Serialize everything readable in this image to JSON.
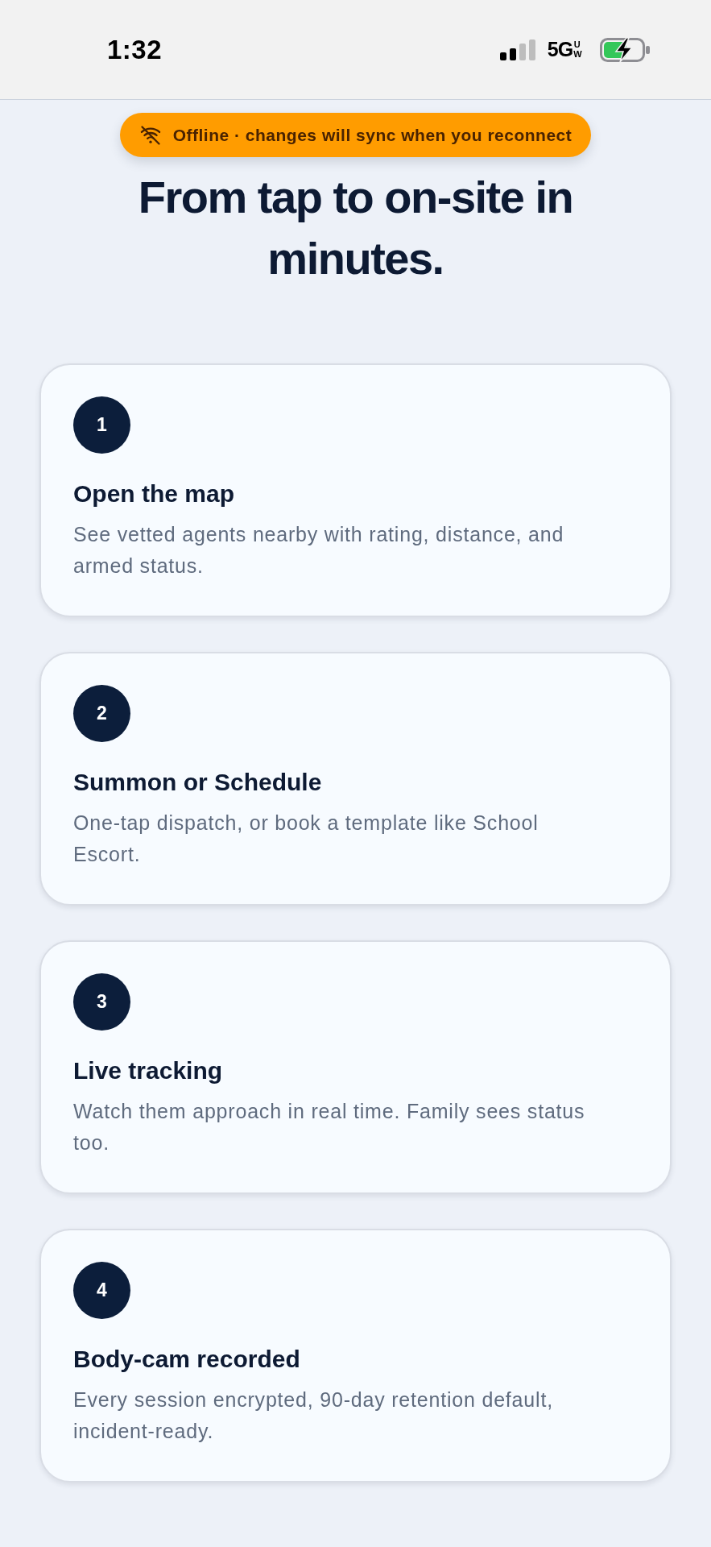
{
  "status_bar": {
    "time": "1:32",
    "network": "5G",
    "network_band": "UW",
    "battery_charging": true
  },
  "offline_banner": {
    "text": "Offline · changes will sync when you reconnect"
  },
  "heading": "From tap to on-site in minutes.",
  "steps": [
    {
      "number": "1",
      "title": "Open the map",
      "description": "See vetted agents nearby with rating, distance, and armed status."
    },
    {
      "number": "2",
      "title": "Summon or Schedule",
      "description": "One-tap dispatch, or book a template like School Escort."
    },
    {
      "number": "3",
      "title": "Live tracking",
      "description": "Watch them approach in real time. Family sees status too."
    },
    {
      "number": "4",
      "title": "Body-cam recorded",
      "description": "Every session encrypted, 90-day retention default, incident-ready."
    }
  ]
}
